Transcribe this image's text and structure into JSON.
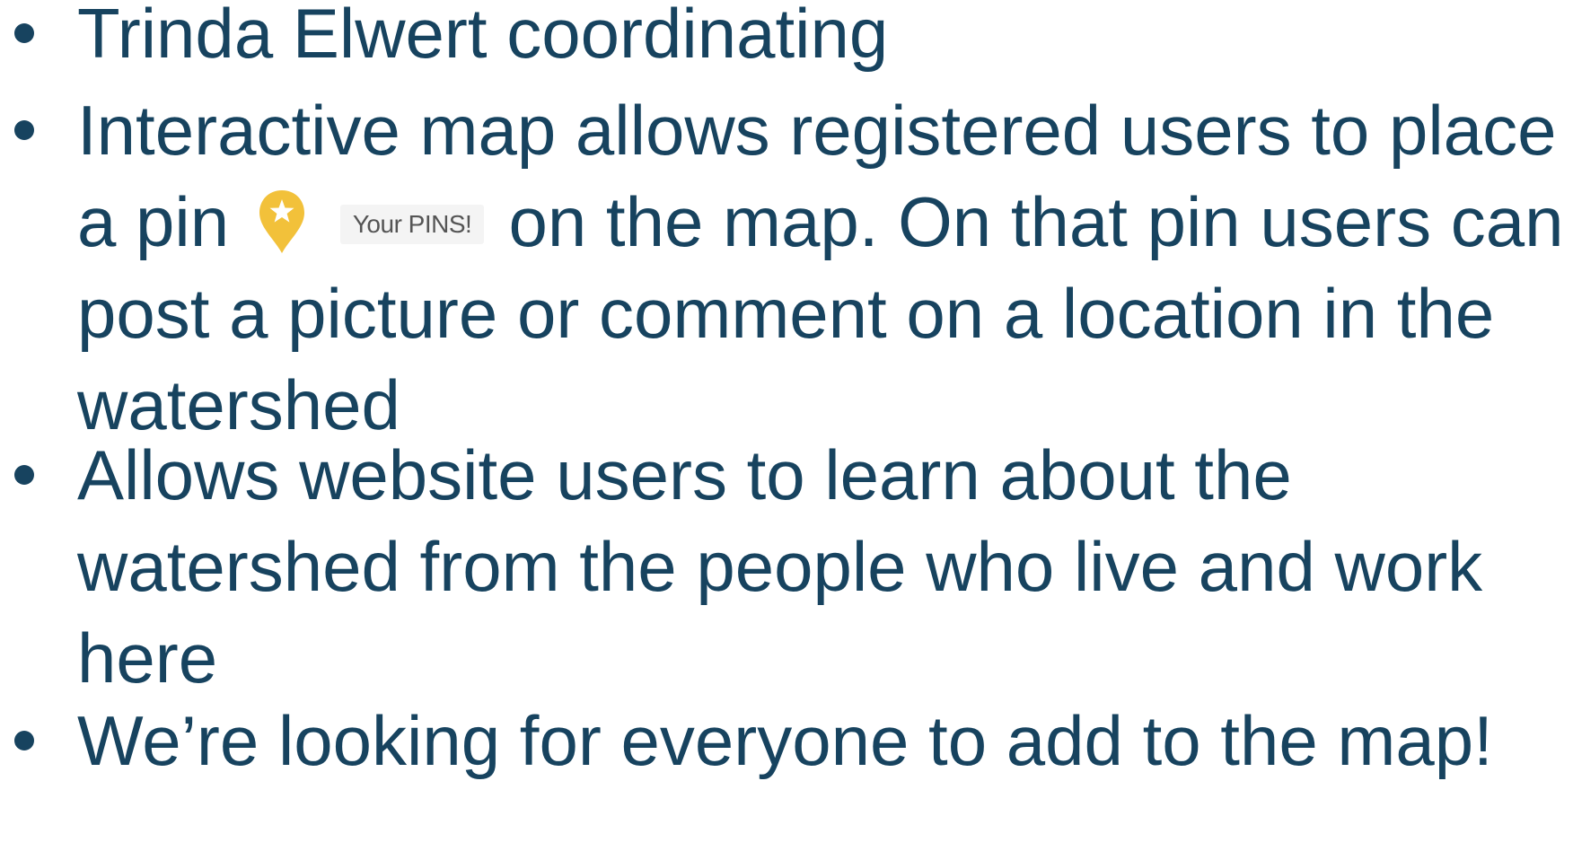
{
  "slide": {
    "bullets": [
      {
        "lines": [
          "Trinda Elwert coordinating"
        ]
      },
      {
        "lines": [
          "Interactive map allows registered users to place",
          {
            "before": "a pin",
            "after": "on the map.  On that pin users can"
          },
          "post a picture or comment on a location in the",
          "watershed"
        ]
      },
      {
        "lines": [
          "Allows website users to learn about the",
          "watershed from the people who live and work",
          "here"
        ]
      },
      {
        "lines": [
          "We’re looking for everyone to add to the map!"
        ]
      }
    ],
    "pin_chip": {
      "icon": "map-pin-star-icon",
      "label": "Your PINS!",
      "pin_color": "#f2c13a",
      "star_color": "#ffffff"
    }
  },
  "colors": {
    "text": "#17435f",
    "background": "#ffffff"
  }
}
